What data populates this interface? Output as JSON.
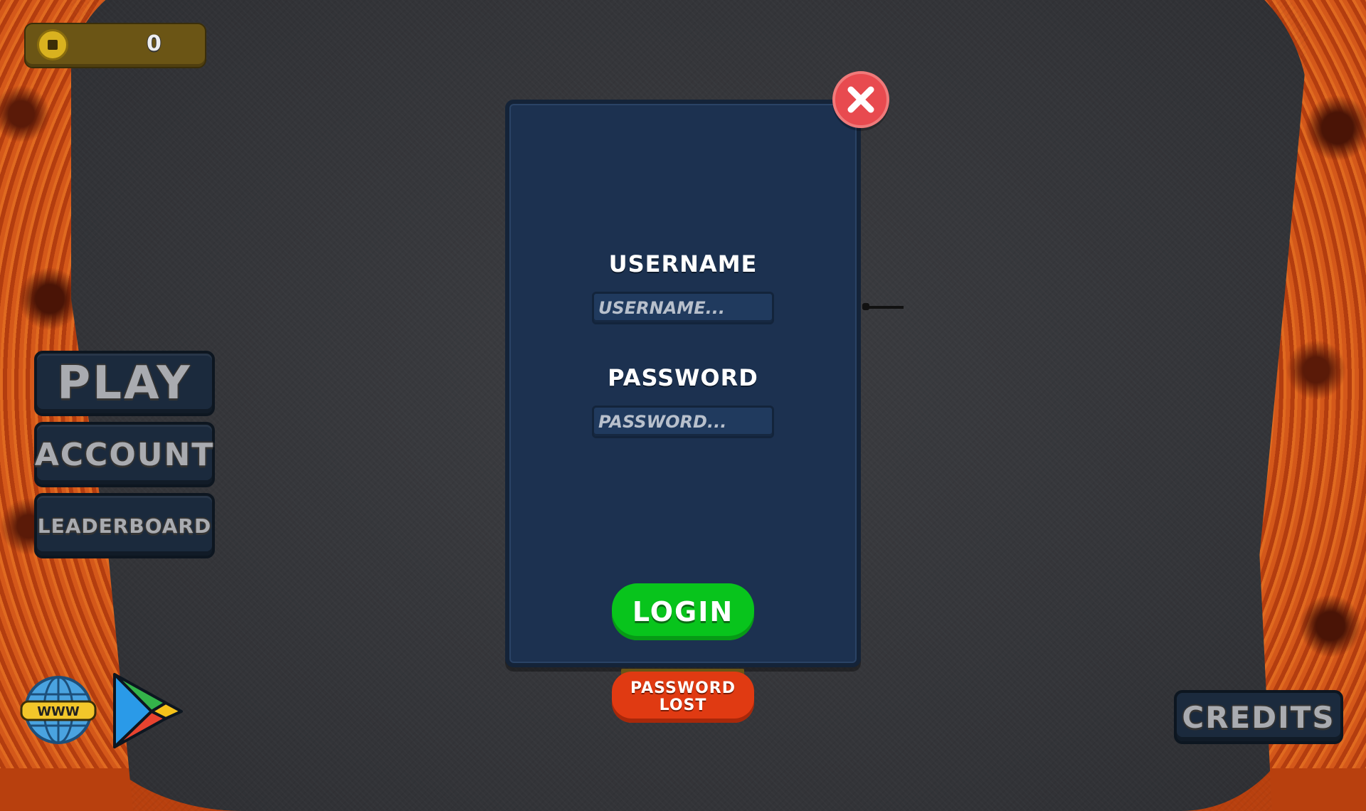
{
  "hud": {
    "coins": "0"
  },
  "menu": {
    "play_label": "PLAY",
    "account_label": "ACCOUNT",
    "leaderboard_label": "LEADERBOARD",
    "credits_label": "CREDITS",
    "website_icon_text": "WWW"
  },
  "login": {
    "username_label": "USERNAME",
    "username_placeholder": "USERNAME...",
    "password_label": "PASSWORD",
    "password_placeholder": "PASSWORD...",
    "login_label": "LOGIN",
    "password_lost_line1": "PASSWORD",
    "password_lost_line2": "LOST"
  },
  "colors": {
    "panel": "#1c3150",
    "login_button": "#08c41c",
    "password_lost_button": "#e03a12",
    "close_button": "#e84a4f",
    "coin_bar": "#6b5515",
    "menu_button": "#1b2a3d"
  }
}
